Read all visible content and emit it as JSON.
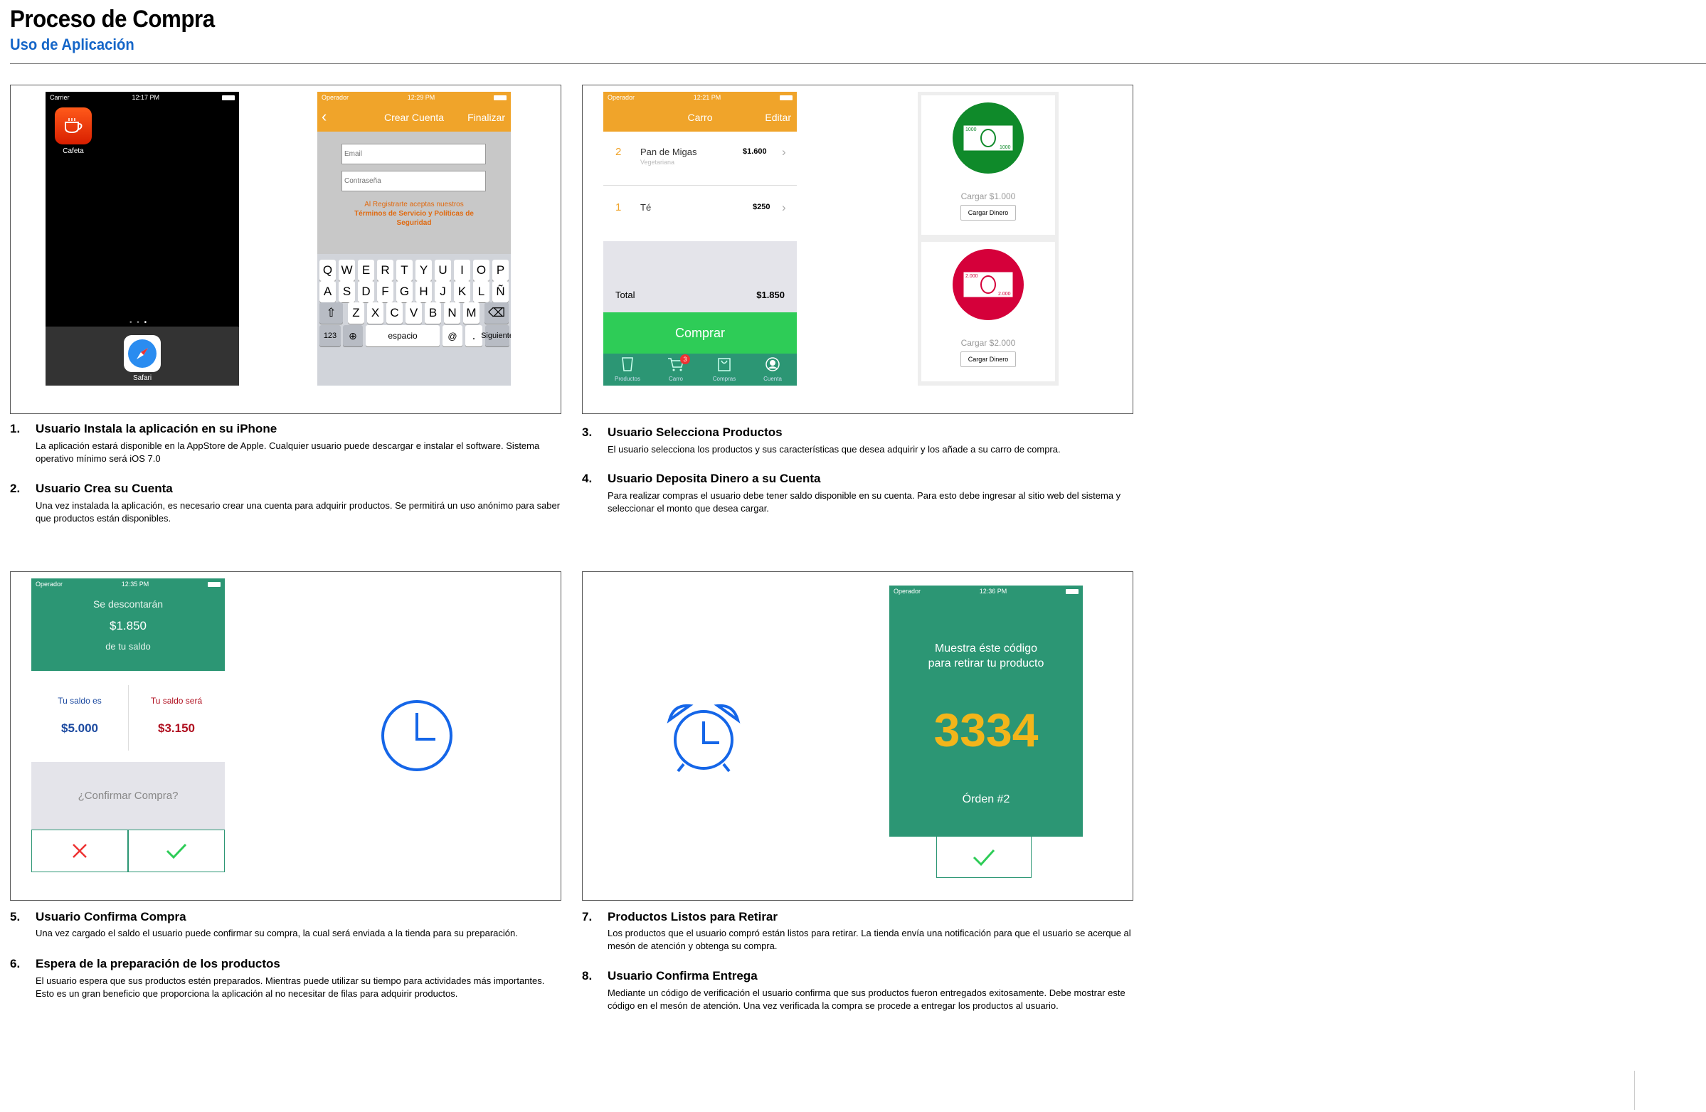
{
  "header": {
    "title": "Proceso de Compra",
    "subtitle": "Uso de Aplicación"
  },
  "phones": {
    "home": {
      "carrier": "Carrier",
      "time": "12:17 PM",
      "app_label": "Cafeta",
      "dock_label": "Safari"
    },
    "signup": {
      "carrier": "Operador",
      "time": "12:29 PM",
      "title": "Crear Cuenta",
      "action": "Finalizar",
      "email_placeholder": "Email",
      "password_placeholder": "Contraseña",
      "terms_line1": "Al Registrarte aceptas nuestros",
      "terms_line2": "Términos de Servicio y Políticas de",
      "terms_line3": "Seguridad",
      "keys_row1": [
        "Q",
        "W",
        "E",
        "R",
        "T",
        "Y",
        "U",
        "I",
        "O",
        "P"
      ],
      "keys_row2": [
        "A",
        "S",
        "D",
        "F",
        "G",
        "H",
        "J",
        "K",
        "L",
        "Ñ"
      ],
      "keys_row3": [
        "Z",
        "X",
        "C",
        "V",
        "B",
        "N",
        "M"
      ],
      "key_123": "123",
      "key_space": "espacio",
      "key_at": "@",
      "key_dot": ".",
      "key_next": "Siguiente"
    },
    "cart": {
      "carrier": "Operador",
      "time": "12:21 PM",
      "title": "Carro",
      "action": "Editar",
      "items": [
        {
          "qty": "2",
          "name": "Pan de Migas",
          "variant": "Vegetariana",
          "price": "$1.600"
        },
        {
          "qty": "1",
          "name": "Té",
          "variant": "",
          "price": "$250"
        }
      ],
      "total_label": "Total",
      "total_value": "$1.850",
      "buy_label": "Comprar",
      "tabs": [
        "Productos",
        "Carro",
        "Compras",
        "Cuenta"
      ],
      "badge": "3"
    },
    "deposit": {
      "cards": [
        {
          "note": "1000",
          "label": "Cargar $1.000",
          "button": "Cargar Dinero",
          "color": "#0f8a2a"
        },
        {
          "note": "2.000",
          "label": "Cargar $2.000",
          "button": "Cargar Dinero",
          "color": "#d5003a"
        }
      ]
    },
    "confirm": {
      "carrier": "Operador",
      "time": "12:35 PM",
      "line1": "Se descontarán",
      "amount": "$1.850",
      "line3": "de tu saldo",
      "balance_label": "Tu saldo es",
      "balance_value": "$5.000",
      "future_label": "Tu saldo será",
      "future_value": "$3.150",
      "question": "¿Confirmar Compra?"
    },
    "code": {
      "carrier": "Operador",
      "time": "12:36 PM",
      "line1": "Muestra éste código",
      "line2": "para retirar tu producto",
      "code": "3334",
      "order": "Órden #2"
    }
  },
  "colors": {
    "accent": "#1566c8",
    "orange": "#f0a42a",
    "green": "#2c9674",
    "bright_green": "#2ecc57"
  },
  "steps": [
    {
      "num": "1.",
      "title": "Usuario Instala la aplicación en su iPhone",
      "text": "La aplicación estará disponible en la AppStore de Apple. Cualquier usuario puede descargar e instalar el software. Sistema operativo mínimo será iOS 7.0"
    },
    {
      "num": "2.",
      "title": "Usuario Crea su Cuenta",
      "text": "Una vez instalada la aplicación, es necesario crear una cuenta para adquirir productos. Se permitirá un uso anónimo para saber que productos están disponibles."
    },
    {
      "num": "3.",
      "title": "Usuario Selecciona  Productos",
      "text": "El usuario selecciona los productos y sus características que desea adquirir y los añade a su carro de compra."
    },
    {
      "num": "4.",
      "title": "Usuario Deposita Dinero a su Cuenta",
      "text": "Para realizar compras el usuario debe tener saldo disponible en su cuenta. Para esto debe ingresar al sitio web del sistema y seleccionar el monto que desea cargar."
    },
    {
      "num": "5.",
      "title": "Usuario Confirma Compra",
      "text": "Una vez cargado el saldo el usuario puede confirmar su compra, la cual será enviada a la tienda para su preparación."
    },
    {
      "num": "6.",
      "title": "Espera de la preparación de los productos",
      "text": "El usuario espera que sus productos estén preparados. Mientras puede utilizar su tiempo para actividades más importantes. Esto es un gran beneficio que proporciona la aplicación al no necesitar de filas para adquirir productos."
    },
    {
      "num": "7.",
      "title": "Productos Listos para Retirar",
      "text": "Los productos que el usuario compró están listos para retirar. La tienda envía una notificación para que el usuario se acerque al mesón de atención y obtenga su compra."
    },
    {
      "num": "8.",
      "title": "Usuario Confirma Entrega",
      "text": "Mediante un código de verificación el usuario confirma que sus productos fueron entregados exitosamente. Debe mostrar este código en el mesón de atención. Una vez verificada la compra se procede a  entregar los productos al usuario."
    }
  ]
}
